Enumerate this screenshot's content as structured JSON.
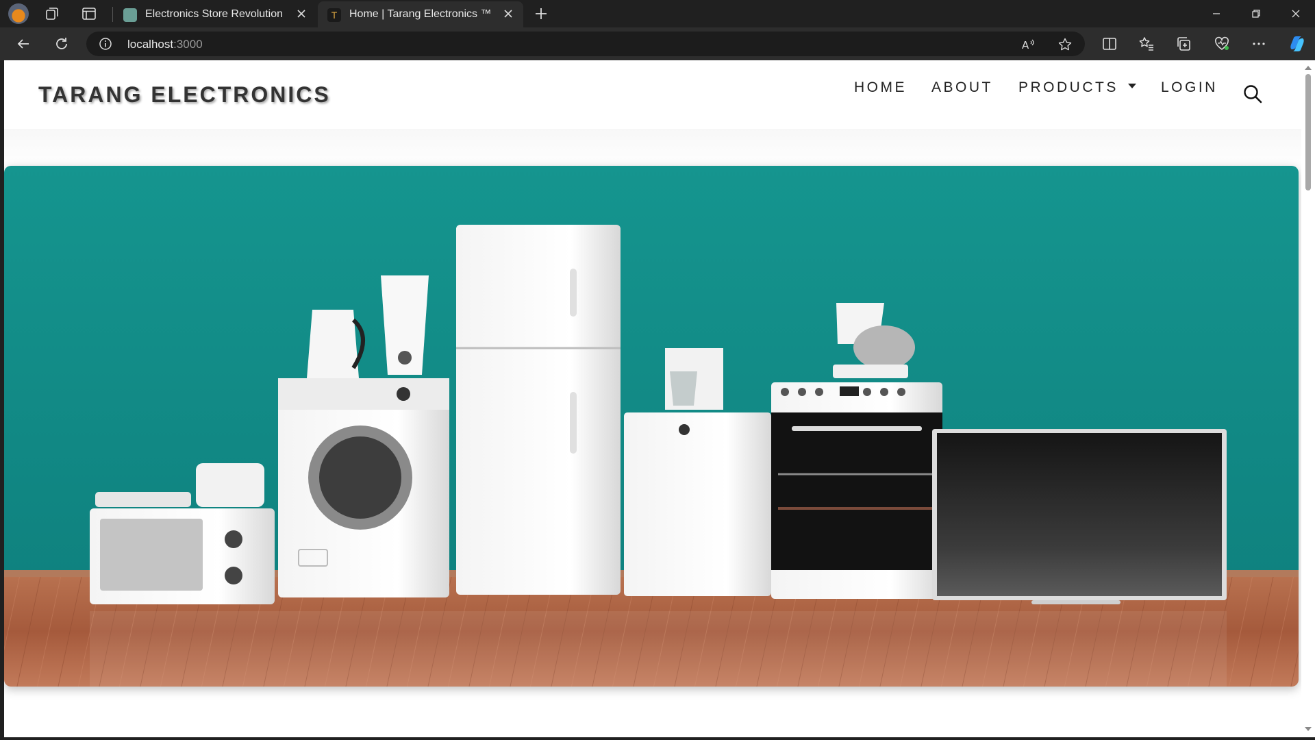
{
  "browser": {
    "tabs": [
      {
        "title": "Electronics Store Revolution",
        "active": false
      },
      {
        "title": "Home | Tarang Electronics ™",
        "active": true
      }
    ],
    "address": {
      "host": "localhost",
      "port": ":3000"
    }
  },
  "site": {
    "brand": "TARANG ELECTRONICS",
    "nav": {
      "home": "HOME",
      "about": "ABOUT",
      "products": "PRODUCTS",
      "login": "LOGIN"
    }
  },
  "hero": {
    "image": "home-appliances-lineup",
    "colors": {
      "wall": "#168f8c",
      "floor": "#a85f40"
    }
  }
}
